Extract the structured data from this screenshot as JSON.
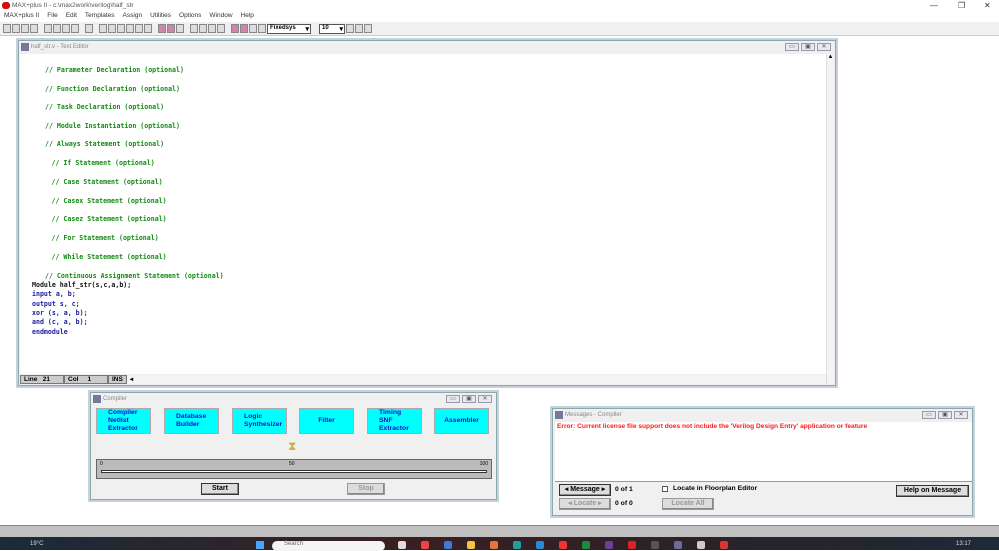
{
  "app": {
    "title": "MAX+plus II - c:\\max2work\\verilog\\half_str"
  },
  "menu": [
    "MAX+plus II",
    "File",
    "Edit",
    "Templates",
    "Assign",
    "Utilities",
    "Options",
    "Window",
    "Help"
  ],
  "toolbar": {
    "font": "Fixedsys",
    "size": "10"
  },
  "editor": {
    "title": "half_str.v - Text Editor",
    "lines": [
      {
        "text": "// Parameter Declaration (optional)",
        "type": "cm",
        "indent": 2
      },
      {
        "text": "// Function Declaration (optional)",
        "type": "cm",
        "indent": 2
      },
      {
        "text": "// Task Declaration (optional)",
        "type": "cm",
        "indent": 2
      },
      {
        "text": "// Module Instantiation (optional)",
        "type": "cm",
        "indent": 2
      },
      {
        "text": "// Always Statement (optional)",
        "type": "cm",
        "indent": 2
      },
      {
        "text": "// If Statement (optional)",
        "type": "cm",
        "indent": 3
      },
      {
        "text": "// Case Statement (optional)",
        "type": "cm",
        "indent": 3
      },
      {
        "text": "// Casex Statement (optional)",
        "type": "cm",
        "indent": 3
      },
      {
        "text": "// Casez Statement (optional)",
        "type": "cm",
        "indent": 3
      },
      {
        "text": "// For Statement (optional)",
        "type": "cm",
        "indent": 3
      },
      {
        "text": "// While Statement (optional)",
        "type": "cm",
        "indent": 3
      },
      {
        "text": "// Continuous Assignment Statement (optional)",
        "type": "cm",
        "indent": 2
      },
      {
        "text": "Module half_str(s,c,a,b);",
        "type": "pl",
        "indent": 0
      },
      {
        "text": "input a, b;",
        "type": "kw",
        "indent": 0
      },
      {
        "text": "output s, c;",
        "type": "kw",
        "indent": 0
      },
      {
        "text": "xor (s, a, b);",
        "type": "kw",
        "indent": 0
      },
      {
        "text": "and (c, a, b);",
        "type": "kw",
        "indent": 0
      },
      {
        "text": "endmodule",
        "type": "kw",
        "indent": 0
      }
    ],
    "status": {
      "line_label": "Line",
      "line": "21",
      "col_label": "Col",
      "col": "1",
      "mode": "INS"
    }
  },
  "compiler": {
    "title": "Compiler",
    "stages": [
      "Compiler\nNetlist\nExtractor",
      "Database\nBuilder",
      "Logic\nSynthesizer",
      "Filter",
      "Timing\nSNF\nExtractor",
      "Assembler"
    ],
    "progress": {
      "min": "0",
      "mid": "50",
      "max": "100",
      "value": 0
    },
    "start": "Start",
    "stop": "Stop"
  },
  "messages": {
    "title": "Messages - Compiler",
    "error": "Error: Current license file support does not include the 'Verilog Design Entry' application or feature",
    "message_btn": "Message",
    "message_count": "0 of 1",
    "locate_btn": "Locate",
    "locate_count": "0 of 0",
    "locate_floorplan": "Locate in Floorplan Editor",
    "locate_all": "Locate All",
    "help": "Help on Message"
  },
  "taskbar": {
    "weather": "19°C",
    "search": "Search",
    "time": "13:17"
  }
}
